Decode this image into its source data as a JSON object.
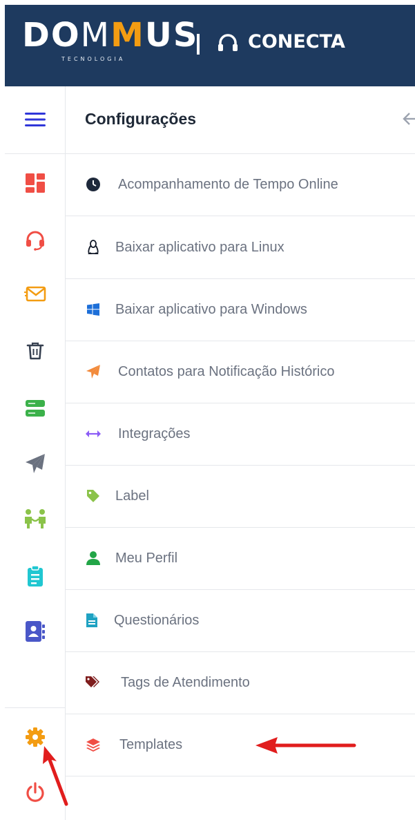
{
  "header": {
    "logo_text_a": "DO",
    "logo_text_m1": "M",
    "logo_text_m2": "M",
    "logo_text_b": "US",
    "logo_sub": "TECNOLOGIA",
    "app_name": "CONECTA"
  },
  "colors": {
    "header_bg": "#1e3a5f",
    "accent": "#f39c12",
    "red_arrow": "#e11d1d"
  },
  "sidebar": {
    "items": [
      {
        "name": "menu-toggle",
        "icon": "hamburger-icon",
        "color": "#2f36d9"
      },
      {
        "name": "dashboard",
        "icon": "dashboard-icon",
        "color": "#f04e45"
      },
      {
        "name": "support",
        "icon": "headset-icon",
        "color": "#f04e45"
      },
      {
        "name": "email",
        "icon": "envelope-icon",
        "color": "#f39c12"
      },
      {
        "name": "trash",
        "icon": "trash-icon",
        "color": "#374151"
      },
      {
        "name": "servers",
        "icon": "server-icon",
        "color": "#3bb14a"
      },
      {
        "name": "send",
        "icon": "paper-plane-icon",
        "color": "#6b7280"
      },
      {
        "name": "team",
        "icon": "people-icon",
        "color": "#8bc34a"
      },
      {
        "name": "clipboard",
        "icon": "clipboard-icon",
        "color": "#20c7d1"
      },
      {
        "name": "contacts",
        "icon": "address-book-icon",
        "color": "#4a57c8"
      },
      {
        "name": "settings",
        "icon": "gear-icon",
        "color": "#f39c12"
      },
      {
        "name": "logout",
        "icon": "power-icon",
        "color": "#f04e45"
      }
    ]
  },
  "panel": {
    "title": "Configurações",
    "items": [
      {
        "label": "Acompanhamento de Tempo Online",
        "icon": "clock-icon",
        "color": "#1e293b"
      },
      {
        "label": "Baixar aplicativo para Linux",
        "icon": "linux-icon",
        "color": "#111827"
      },
      {
        "label": "Baixar aplicativo para Windows",
        "icon": "windows-icon",
        "color": "#1d6fd8"
      },
      {
        "label": "Contatos para Notificação Histórico",
        "icon": "paper-plane-icon",
        "color": "#f28a3b"
      },
      {
        "label": "Integrações",
        "icon": "arrows-horizontal-icon",
        "color": "#8b5cf6"
      },
      {
        "label": "Label",
        "icon": "tag-icon",
        "color": "#8bc34a"
      },
      {
        "label": "Meu Perfil",
        "icon": "user-icon",
        "color": "#22a547"
      },
      {
        "label": "Questionários",
        "icon": "file-icon",
        "color": "#1fa2c2"
      },
      {
        "label": "Tags de Atendimento",
        "icon": "tags-icon",
        "color": "#7f1d1d"
      },
      {
        "label": "Templates",
        "icon": "layers-icon",
        "color": "#f04e45"
      }
    ]
  }
}
